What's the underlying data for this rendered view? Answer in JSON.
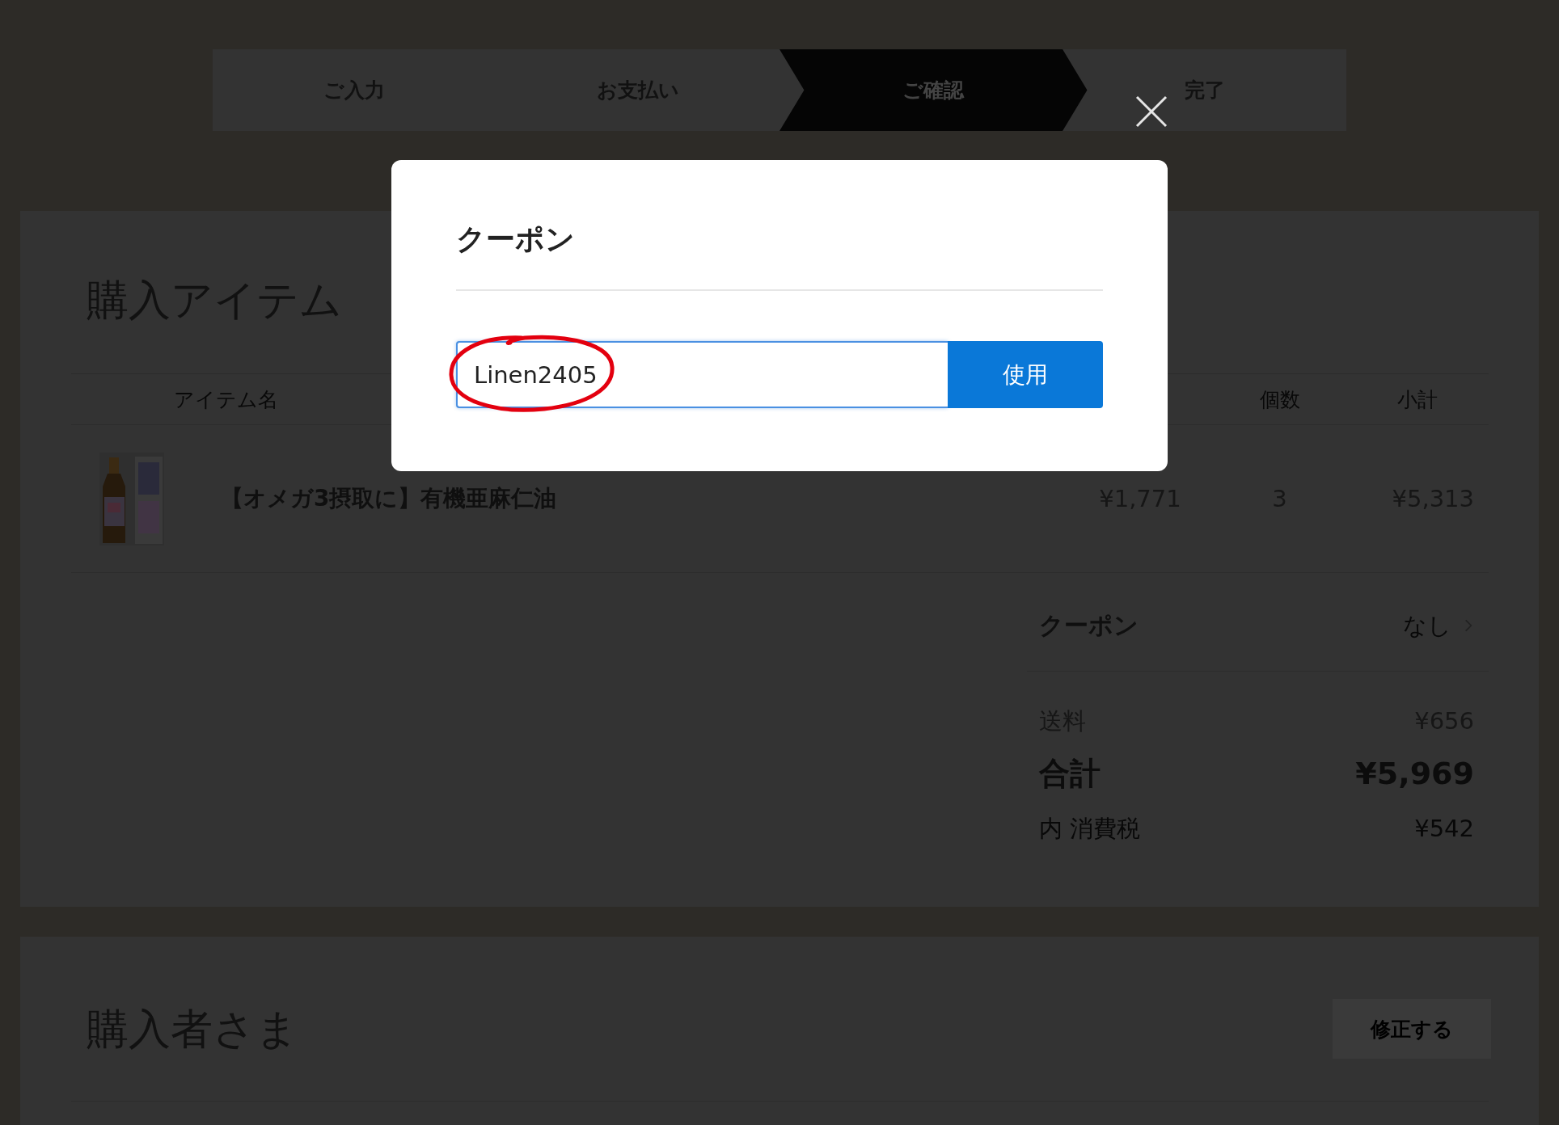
{
  "steps": [
    {
      "label": "ご入力",
      "selected": false
    },
    {
      "label": "お支払い",
      "selected": false
    },
    {
      "label": "ご確認",
      "selected": true
    },
    {
      "label": "完了",
      "selected": false
    }
  ],
  "items_section": {
    "title": "購入アイテム",
    "columns": [
      {
        "kind": "name",
        "label": "アイテム名"
      },
      {
        "kind": "quantity",
        "label": "個数"
      },
      {
        "kind": "subtotal",
        "label": "小計"
      }
    ],
    "rows": [
      {
        "name": "【オメガ3摂取に】有機亜麻仁油",
        "price": "¥1,771",
        "quantity": "3",
        "subtotal": "¥5,313"
      }
    ]
  },
  "summary": {
    "coupon": {
      "label": "クーポン",
      "value": "なし"
    },
    "lines": [
      {
        "kind": "normal",
        "label": "送料",
        "value": "¥656"
      },
      {
        "kind": "total",
        "label": "合計",
        "value": "¥5,969"
      },
      {
        "kind": "tax",
        "label": "内 消費税",
        "value": "¥542"
      }
    ]
  },
  "buyer_section": {
    "title": "購入者さま",
    "edit_button": "修正する"
  },
  "modal": {
    "title": "クーポン",
    "input": {
      "value": "Linen2405"
    },
    "submit": "使用",
    "circled": true
  }
}
